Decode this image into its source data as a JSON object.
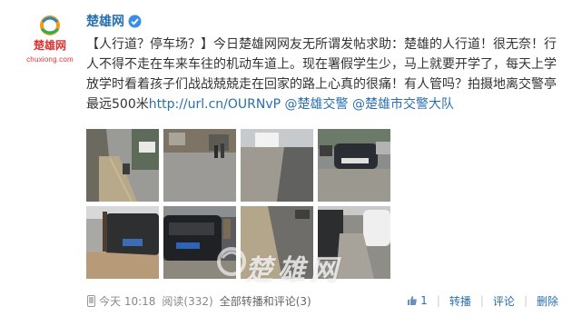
{
  "profile": {
    "name": "楚雄网",
    "site": "chuxiong.com"
  },
  "post": {
    "text_before_link": "【人行道？停车场？】今日楚雄网网友无所谓发帖求助：楚雄的人行道！很无奈！行人不得不走在车来车往的机动车道上。现在署假学生少，马上就要开学了，每天上学放学时看着孩子们战战兢兢走在回家的路上心真的很痛！有人管吗？拍摄地离交警亭最远500米",
    "link": "http://url.cn/OURNvP",
    "mention1": "@楚雄交警",
    "mention2": "@楚雄市交警大队"
  },
  "watermark": "楚雄网",
  "meta": {
    "time": "今天 10:18",
    "reads": "阅读(332)",
    "forward_comments": "全部转播和评论(3)"
  },
  "actions": {
    "like": "1",
    "forward": "转播",
    "comment": "评论",
    "delete": "删除"
  },
  "colors": {
    "link": "#2a6fb0",
    "brand_red": "#d33",
    "muted": "#888"
  },
  "icons": [
    "logo-avatar",
    "verified-icon",
    "phone-icon",
    "thumbs-up-icon"
  ]
}
